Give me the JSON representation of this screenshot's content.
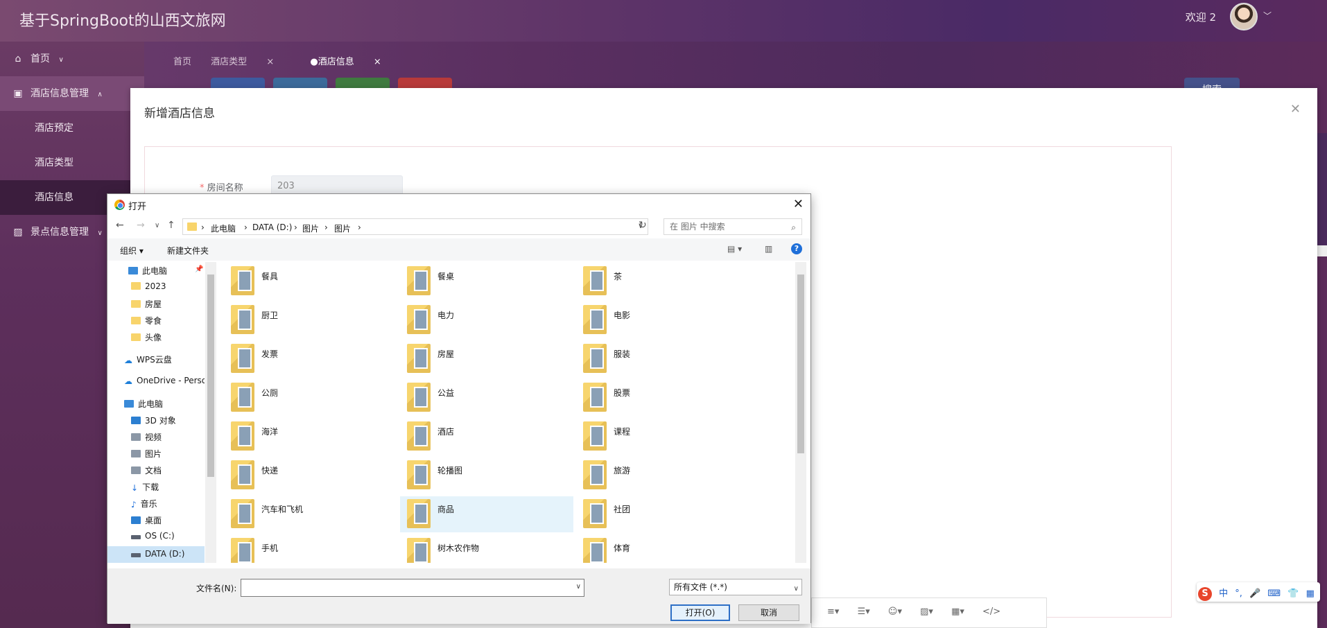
{
  "app": {
    "title": "基于SpringBoot的山西文旅网",
    "welcome": "欢迎 2"
  },
  "sidebar": {
    "home": "首页",
    "hotel_mgmt": "酒店信息管理",
    "hotel_booking": "酒店预定",
    "hotel_type": "酒店类型",
    "hotel_info": "酒店信息",
    "scenic_mgmt": "景点信息管理"
  },
  "tabs": [
    {
      "label": "首页"
    },
    {
      "label": "酒店类型"
    },
    {
      "label": "●酒店信息"
    }
  ],
  "toolbar": {
    "search": "搜索"
  },
  "modal": {
    "title": "新增酒店信息",
    "room_name_label": "房间名称",
    "room_name_value": "203"
  },
  "dialog": {
    "title": "打开",
    "breadcrumbs": [
      "此电脑",
      "DATA (D:)",
      "图片",
      "图片"
    ],
    "search_placeholder": "在 图片 中搜索",
    "organize": "组织",
    "new_folder": "新建文件夹",
    "tree": [
      {
        "label": "此电脑",
        "icon": "pc-icon"
      },
      {
        "label": "2023",
        "icon": "folder-icon"
      },
      {
        "label": "房屋",
        "icon": "folder-icon"
      },
      {
        "label": "零食",
        "icon": "folder-icon"
      },
      {
        "label": "头像",
        "icon": "folder-icon"
      },
      {
        "label": "WPS云盘",
        "icon": "cloud-icon"
      },
      {
        "label": "OneDrive - Perso",
        "icon": "cloud-icon"
      },
      {
        "label": "此电脑",
        "icon": "pc-icon"
      },
      {
        "label": "3D 对象",
        "icon": "cube-icon"
      },
      {
        "label": "视频",
        "icon": "video-icon"
      },
      {
        "label": "图片",
        "icon": "picture-icon"
      },
      {
        "label": "文档",
        "icon": "document-icon"
      },
      {
        "label": "下载",
        "icon": "download-icon"
      },
      {
        "label": "音乐",
        "icon": "music-icon"
      },
      {
        "label": "桌面",
        "icon": "desktop-icon"
      },
      {
        "label": "OS (C:)",
        "icon": "drive-icon"
      },
      {
        "label": "DATA (D:)",
        "icon": "drive-icon"
      }
    ],
    "folders": [
      "餐具",
      "餐桌",
      "茶",
      "厨卫",
      "电力",
      "电影",
      "发票",
      "房屋",
      "服装",
      "公厕",
      "公益",
      "股票",
      "海洋",
      "酒店",
      "课程",
      "快递",
      "轮播图",
      "旅游",
      "汽车和飞机",
      "商品",
      "社团",
      "手机",
      "树木农作物",
      "体育"
    ],
    "filename_label": "文件名(N):",
    "filename_value": "",
    "filetype": "所有文件 (*.*)",
    "open_button": "打开(O)",
    "cancel_button": "取消"
  },
  "ime": {
    "lang": "中"
  }
}
